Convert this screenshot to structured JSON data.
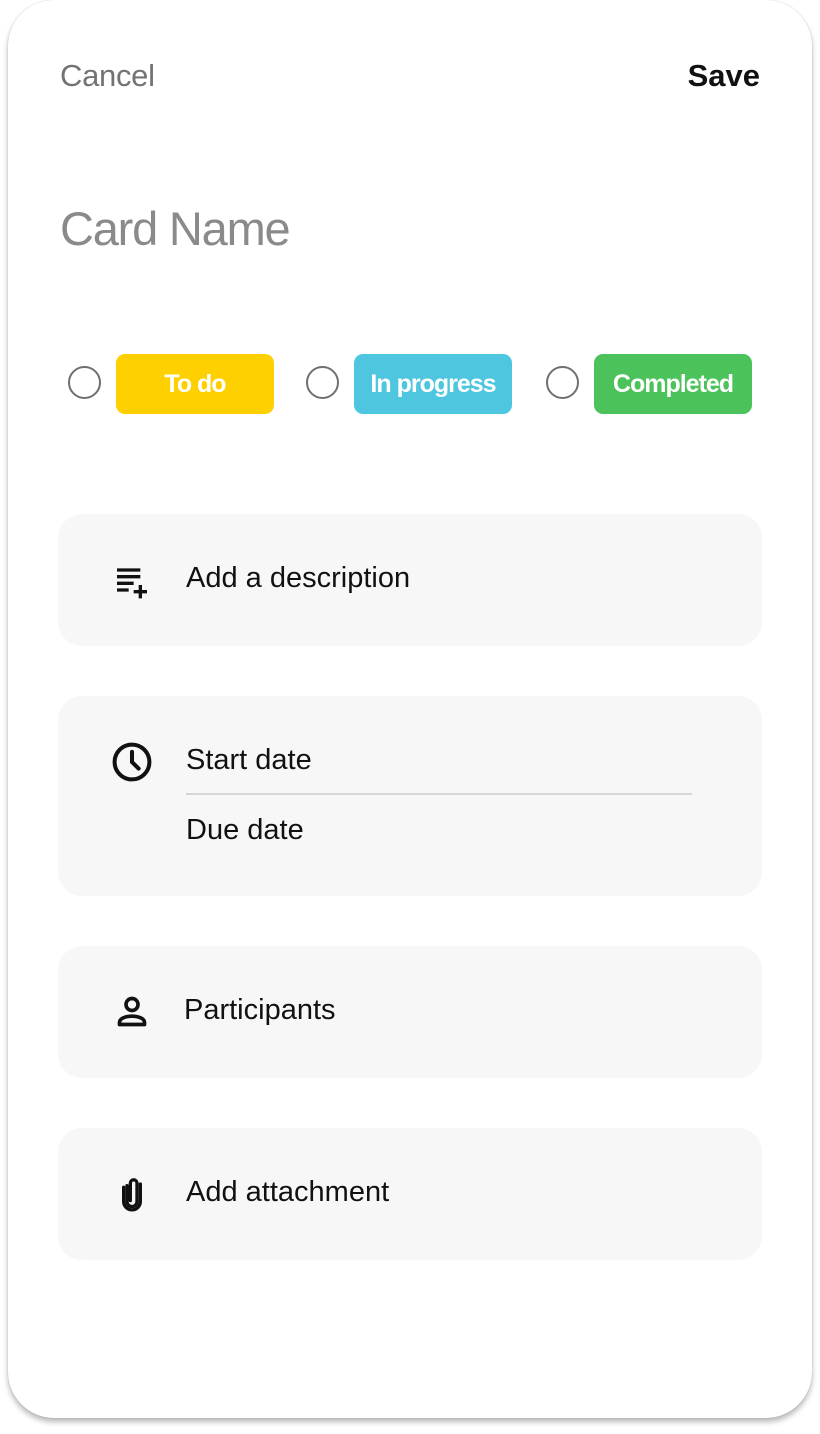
{
  "header": {
    "cancel_label": "Cancel",
    "save_label": "Save"
  },
  "card": {
    "name_placeholder": "Card Name",
    "name_value": ""
  },
  "statuses": [
    {
      "label": "To do",
      "color": "#FFD000",
      "selected": false
    },
    {
      "label": "In progress",
      "color": "#4FC6E0",
      "selected": false
    },
    {
      "label": "Completed",
      "color": "#4CC25B",
      "selected": false
    }
  ],
  "sections": {
    "description": {
      "label": "Add a description",
      "icon": "playlist-add-icon"
    },
    "dates": {
      "start_label": "Start date",
      "due_label": "Due date",
      "icon": "clock-icon"
    },
    "participants": {
      "label": "Participants",
      "icon": "person-icon"
    },
    "attachment": {
      "label": "Add attachment",
      "icon": "paperclip-icon"
    }
  },
  "colors": {
    "section_background": "#F7F7F7",
    "muted_text": "#737373"
  }
}
